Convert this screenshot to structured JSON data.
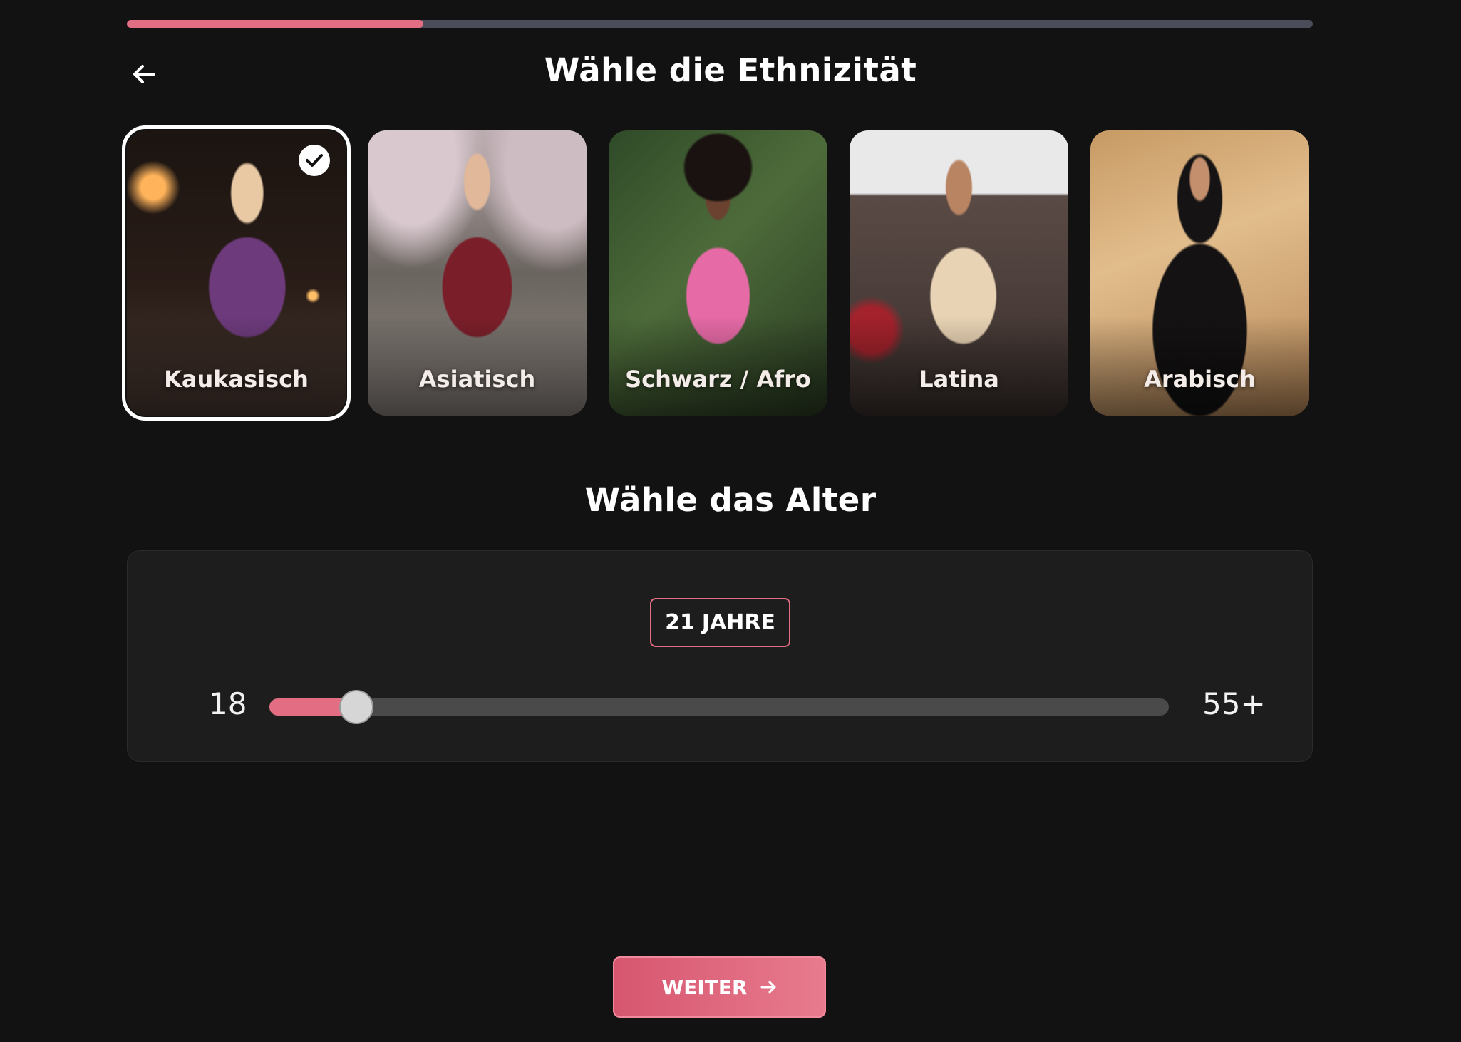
{
  "progress": {
    "value": 0.25,
    "color": "#e36d82"
  },
  "header": {
    "title": "Wähle die Ethnizität",
    "back_icon": "arrow-left-icon"
  },
  "ethnicities": [
    {
      "label": "Kaukasisch",
      "selected": true
    },
    {
      "label": "Asiatisch",
      "selected": false
    },
    {
      "label": "Schwarz / Afro",
      "selected": false
    },
    {
      "label": "Latina",
      "selected": false
    },
    {
      "label": "Arabisch",
      "selected": false
    }
  ],
  "age": {
    "title": "Wähle das Alter",
    "value": "21",
    "unit": "JAHRE",
    "min_label": "18",
    "max_label": "55+",
    "slider_fraction": 0.097
  },
  "footer": {
    "next_label": "WEITER",
    "next_icon": "arrow-right-icon"
  },
  "colors": {
    "accent": "#e36d82",
    "background": "#121212",
    "panel": "#1d1d1e"
  }
}
